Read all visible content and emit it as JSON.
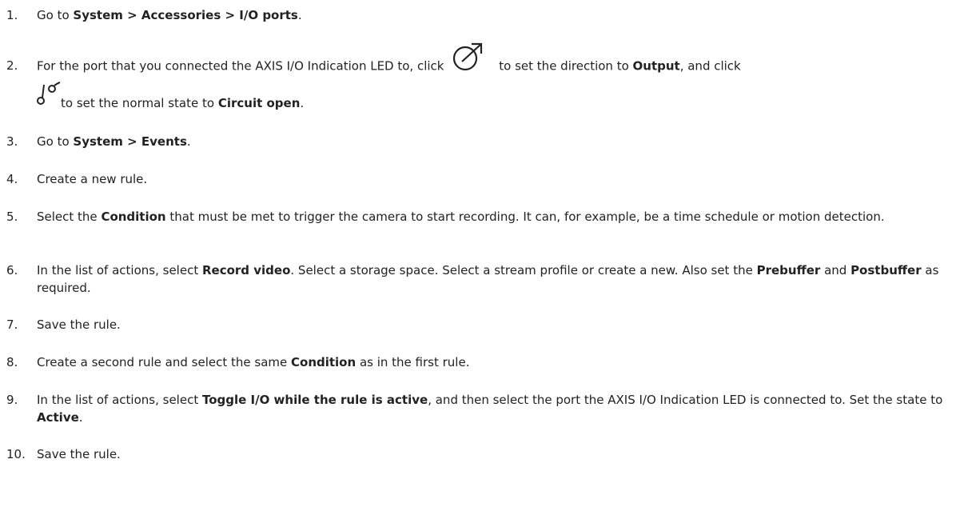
{
  "steps": [
    {
      "num": "1.",
      "parts": [
        {
          "t": "Go to "
        },
        {
          "b": "System > Accessories > I/O ports"
        },
        {
          "t": "."
        }
      ]
    },
    {
      "num": "2.",
      "text_a": "For the port that you connected the AXIS I/O Indication LED to, click",
      "icon_a": "output-direction-icon",
      "text_b": "to set the direction to ",
      "bold_b": "Output",
      "text_c": ", and click",
      "icon_b": "circuit-open-icon",
      "text_d": "to set the normal state to ",
      "bold_d": "Circuit open",
      "text_e": "."
    },
    {
      "num": "3.",
      "parts": [
        {
          "t": "Go to "
        },
        {
          "b": "System > Events"
        },
        {
          "t": "."
        }
      ]
    },
    {
      "num": "4.",
      "parts": [
        {
          "t": "Create a new rule."
        }
      ]
    },
    {
      "num": "5.",
      "parts": [
        {
          "t": "Select the "
        },
        {
          "b": "Condition"
        },
        {
          "t": " that must be met to trigger the camera to start recording. It can, for example, be a time schedule or motion detection."
        }
      ]
    },
    {
      "num": "6.",
      "parts": [
        {
          "t": "In the list of actions, select "
        },
        {
          "b": "Record video"
        },
        {
          "t": ". Select a storage space. Select a stream profile or create a new. Also set the "
        },
        {
          "b": "Prebuffer"
        },
        {
          "t": " and "
        },
        {
          "b": "Postbuffer"
        },
        {
          "t": " as required."
        }
      ]
    },
    {
      "num": "7.",
      "parts": [
        {
          "t": "Save the rule."
        }
      ]
    },
    {
      "num": "8.",
      "parts": [
        {
          "t": "Create a second rule and select the same "
        },
        {
          "b": "Condition"
        },
        {
          "t": " as in the first rule."
        }
      ]
    },
    {
      "num": "9.",
      "parts": [
        {
          "t": "In the list of actions, select "
        },
        {
          "b": "Toggle I/O while the rule is active"
        },
        {
          "t": ", and then select the port the AXIS I/O Indication LED is connected to.  Set the state to "
        },
        {
          "b": "Active"
        },
        {
          "t": "."
        }
      ]
    },
    {
      "num": "10.",
      "parts": [
        {
          "t": "Save the rule."
        }
      ]
    }
  ]
}
